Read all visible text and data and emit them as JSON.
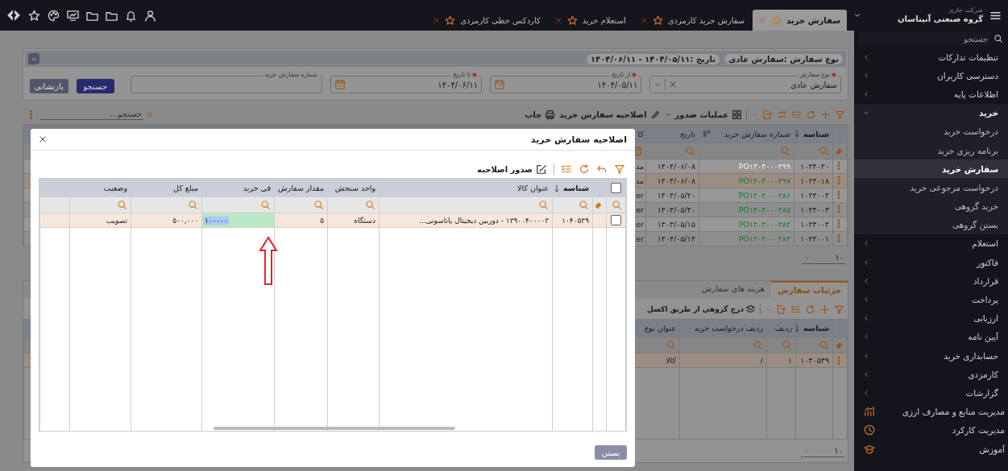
{
  "top_bar": {
    "company_caption": "شرکت جاری",
    "company_name": "گروه صنعتی آنیتاسان",
    "tabs": [
      {
        "label": "سفارش خرید",
        "selected": true
      },
      {
        "label": "سفارش خرید کارمزدی",
        "selected": false
      },
      {
        "label": "استعلام خرید",
        "selected": false
      },
      {
        "label": "کاردکس خطی کارمزدی",
        "selected": false
      }
    ]
  },
  "sidebar": {
    "search_placeholder": "جستجو",
    "items": [
      {
        "label": "تنظیمات تدارکات",
        "kind": "group",
        "expanded": false
      },
      {
        "label": "دسترسی کاربران",
        "kind": "group",
        "expanded": false
      },
      {
        "label": "اطلاعات پایه",
        "kind": "group",
        "expanded": false
      },
      {
        "label": "خرید",
        "kind": "group",
        "expanded": true,
        "children": [
          {
            "label": "درخواست خرید",
            "selected": false
          },
          {
            "label": "برنامه ریزی خرید",
            "selected": false
          },
          {
            "label": "سفارش خرید",
            "selected": true
          },
          {
            "label": "درخواست مرجوعی خرید",
            "selected": false
          },
          {
            "label": "خرید گروهی",
            "selected": false
          },
          {
            "label": "بستن گروهی",
            "selected": false
          }
        ]
      },
      {
        "label": "استعلام",
        "kind": "group",
        "expanded": false
      },
      {
        "label": "فاکتور",
        "kind": "group",
        "expanded": false
      },
      {
        "label": "قرارداد",
        "kind": "group",
        "expanded": false
      },
      {
        "label": "پرداخت",
        "kind": "group",
        "expanded": false
      },
      {
        "label": "ارزیابی",
        "kind": "group",
        "expanded": false
      },
      {
        "label": "آیین نامه",
        "kind": "group",
        "expanded": false
      },
      {
        "label": "حسابداری خرید",
        "kind": "group",
        "expanded": false
      },
      {
        "label": "کارمزدی",
        "kind": "group",
        "expanded": false
      },
      {
        "label": "گزارشات",
        "kind": "group",
        "expanded": false
      },
      {
        "label": "مدیریت منابع و مصارف ارزی",
        "kind": "module"
      },
      {
        "label": "مدیریت کارکرد",
        "kind": "module"
      },
      {
        "label": "آموزش",
        "kind": "module"
      }
    ]
  },
  "filter_panel": {
    "summary": [
      "نوع سفارش :سفارش عادی",
      "تاریخ :۱۴۰۴/۰۵/۱۱ - ۱۴۰۴/۰۶/۱۱"
    ],
    "fields": [
      {
        "label": "نوع سفارش",
        "required": true,
        "kind": "select",
        "value": "سفارش عادی"
      },
      {
        "label": "از تاریخ",
        "required": true,
        "kind": "date",
        "value": "۱۴۰۴/۰۵/۱۱"
      },
      {
        "label": "تا تاریخ",
        "required": true,
        "kind": "date",
        "value": "۱۴۰۴/۰۶/۱۱"
      },
      {
        "label": "شماره سفارش خرید",
        "required": false,
        "kind": "text"
      }
    ],
    "search_button": "جستجو",
    "reset_button": "بازنشانی"
  },
  "toolbar": {
    "issue_menu": "عملیات صدور",
    "amend_action": "اصلاحیه سفارش خرید",
    "print_action": "چاپ",
    "search_placeholder": "جستجو..."
  },
  "orders_table": {
    "columns": [
      {
        "label": "شناسه",
        "sorted": true
      },
      {
        "label": "شماره سفارش خرید",
        "sorted": false
      },
      {
        "label": "تاریخ",
        "sorted": false
      },
      {
        "label": "کا",
        "sorted": false
      }
    ],
    "rows": [
      {
        "id": "۱۰۲۴۰۲۰",
        "number": "PO۱۴۰۴۰۰۰۲۹۹",
        "color": "#f2f2f2",
        "date": "۱۴۰۴/۰۶/۰۸",
        "column_4": "مد",
        "selected": false
      },
      {
        "id": "۱۰۲۴۰۱۸",
        "number": "PO۱۴۰۴۰۰۰۲۹۷",
        "color": "#157a2e",
        "date": "۱۴۰۴/۰۶/۰۸",
        "column_4": "مد",
        "selected": true
      },
      {
        "id": "۱۰۲۴۰۰۴",
        "number": "PO۱۴۰۴۰۰۰۲۸۶",
        "color": "#157a2e",
        "date": "۱۴۰۴/۰۵/۲۰",
        "column_4": "er",
        "selected": false
      },
      {
        "id": "۱۰۲۴۰۰۳",
        "number": "PO۱۴۰۴۰۰۰۲۸۵",
        "color": "#157a2e",
        "date": "۱۴۰۴/۰۵/۲۰",
        "column_4": "er",
        "selected": false
      },
      {
        "id": "۱۰۲۴۰۰۲",
        "number": "PO۱۴۰۴۰۰۰۲۸۴",
        "color": "#157a2e",
        "date": "۱۴۰۴/۰۵/۱۵",
        "column_4": "er",
        "selected": false
      },
      {
        "id": "۱۰۲۴۰۰۱",
        "number": "PO۱۴۰۴۰۰۰۲۸۳",
        "color": "#157a2e",
        "date": "۱۴۰۴/۰۵/۱۴",
        "column_4": "er",
        "selected": false
      }
    ],
    "page_size": "۱۰"
  },
  "details": {
    "tabs": [
      {
        "label": "جزئیات سفارش",
        "selected": true
      },
      {
        "label": "هزینه های سفارش",
        "selected": false
      }
    ],
    "import_action": "درج گروهی از طریق اکسل",
    "columns": [
      {
        "label": "شناسه",
        "sorted": true
      },
      {
        "label": "ردیف",
        "sorted": false
      },
      {
        "label": "ردیف درخواست خرید",
        "sorted": false
      },
      {
        "label": "عنوان نوع",
        "sorted": false
      }
    ],
    "rows": [
      {
        "cells": [
          "۱۰۴۰۵۳۹",
          "۱",
          "/",
          "کالا"
        ]
      }
    ],
    "page_size": "۱۰"
  },
  "modal": {
    "title": "اصلاحیه سفارش خرید",
    "issue_action": "صدور اصلاحیه",
    "all_checked": false,
    "columns": [
      {
        "label": "شناسه",
        "sorted": true
      },
      {
        "label": "عنوان کالا",
        "sorted": false
      },
      {
        "label": "واحد سنجش",
        "sorted": false
      },
      {
        "label": "مقدار سفارش",
        "sorted": false
      },
      {
        "label": "فی خرید",
        "sorted": false
      },
      {
        "label": "مبلغ کل",
        "sorted": false
      },
      {
        "label": "وضعیت",
        "sorted": false
      }
    ],
    "rows": [
      {
        "checked": false,
        "id": "۱۰۴۰۵۳۹",
        "item": "۱۳۹۰۰۴۰۰۰۰۳ - دوربین دیجیتال پاناسونی...",
        "unit": "دستگاه",
        "quantity": "۵",
        "unit_price": {
          "value": "۱۰۰۰۰۰",
          "editing": true
        },
        "total": "۵۰۰,۰۰۰",
        "status": "تصویب"
      }
    ],
    "close_button": "بستن"
  }
}
